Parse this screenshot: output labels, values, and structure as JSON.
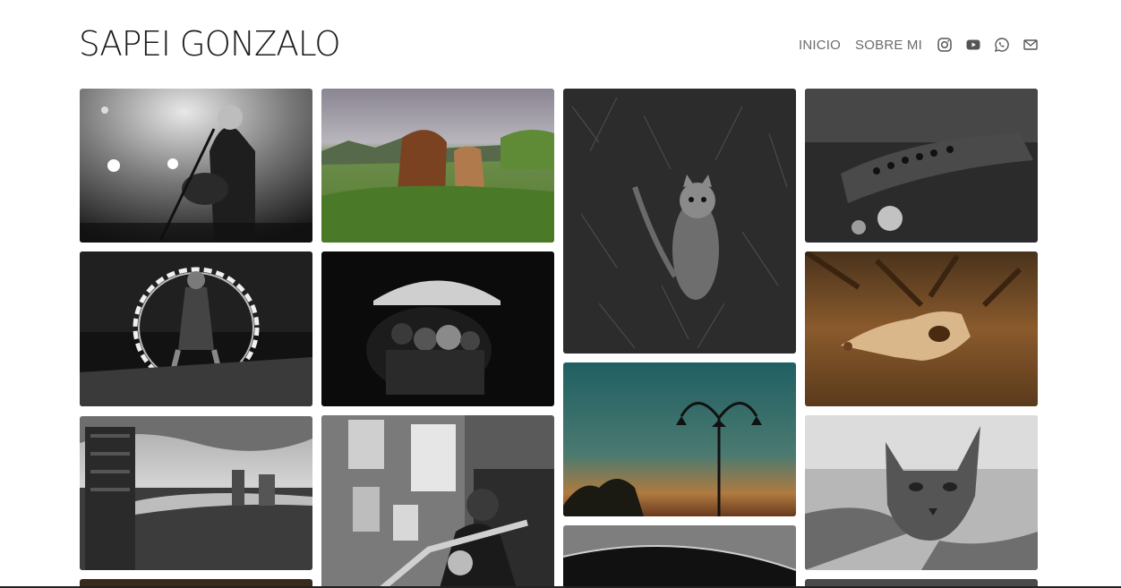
{
  "header": {
    "site_title": "SAPEI GONZALO",
    "nav": [
      {
        "label": "INICIO"
      },
      {
        "label": "SOBRE MI"
      }
    ],
    "social_icons": [
      "instagram-icon",
      "youtube-icon",
      "whatsapp-icon",
      "mail-icon"
    ]
  },
  "colors": {
    "title_text": "#1b1b1b",
    "nav_text": "#6b6b6b",
    "background": "#ffffff"
  },
  "gallery": {
    "photos": [
      "guitarist-singer-on-stage",
      "horses-grazing",
      "cat-in-grass",
      "hollow-log",
      "fire-hoop-performer",
      "crowd-through-dark-frame",
      "street-lamp-at-dusk",
      "animal-skull-on-leaves",
      "city-coastline-skyline",
      "trombone-player-with-posters",
      "cat-portrait",
      "curved-roof-edge"
    ]
  }
}
